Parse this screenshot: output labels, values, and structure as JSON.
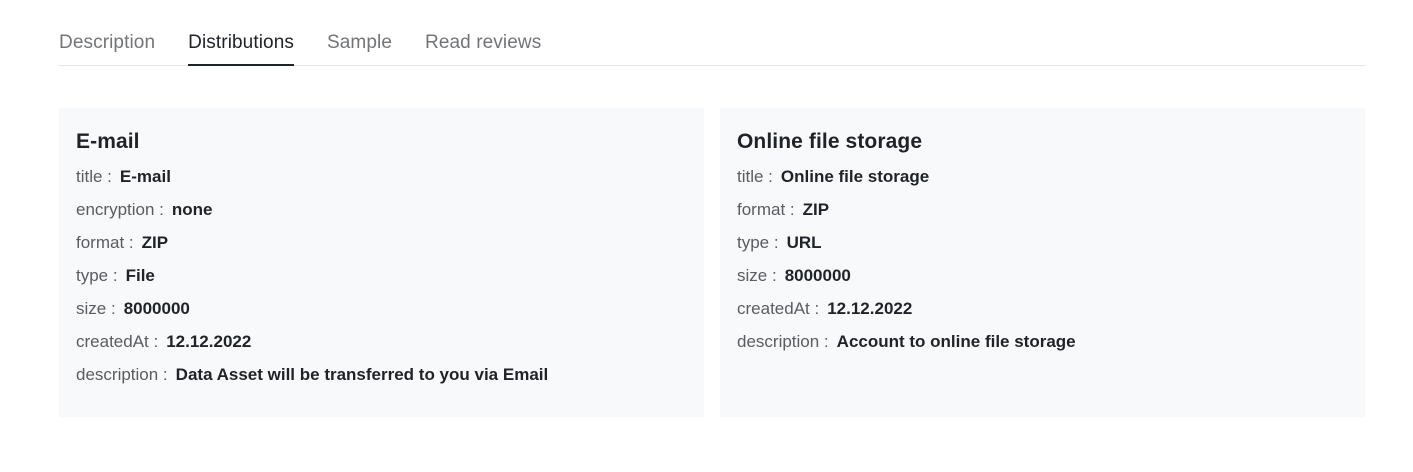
{
  "tabs": [
    {
      "label": "Description",
      "active": false
    },
    {
      "label": "Distributions",
      "active": true
    },
    {
      "label": "Sample",
      "active": false
    },
    {
      "label": "Read reviews",
      "active": false
    }
  ],
  "distributions": [
    {
      "title": "E-mail",
      "fields": [
        {
          "key": "title :",
          "value": "E-mail"
        },
        {
          "key": "encryption :",
          "value": "none"
        },
        {
          "key": "format :",
          "value": "ZIP"
        },
        {
          "key": "type :",
          "value": "File"
        },
        {
          "key": "size :",
          "value": "8000000"
        },
        {
          "key": "createdAt :",
          "value": "12.12.2022"
        },
        {
          "key": "description :",
          "value": "Data Asset will be transferred to you via Email"
        }
      ]
    },
    {
      "title": "Online file storage",
      "fields": [
        {
          "key": "title :",
          "value": "Online file storage"
        },
        {
          "key": "format :",
          "value": "ZIP"
        },
        {
          "key": "type :",
          "value": "URL"
        },
        {
          "key": "size :",
          "value": "8000000"
        },
        {
          "key": "createdAt :",
          "value": "12.12.2022"
        },
        {
          "key": "description :",
          "value": "Account to online file storage"
        }
      ]
    }
  ]
}
